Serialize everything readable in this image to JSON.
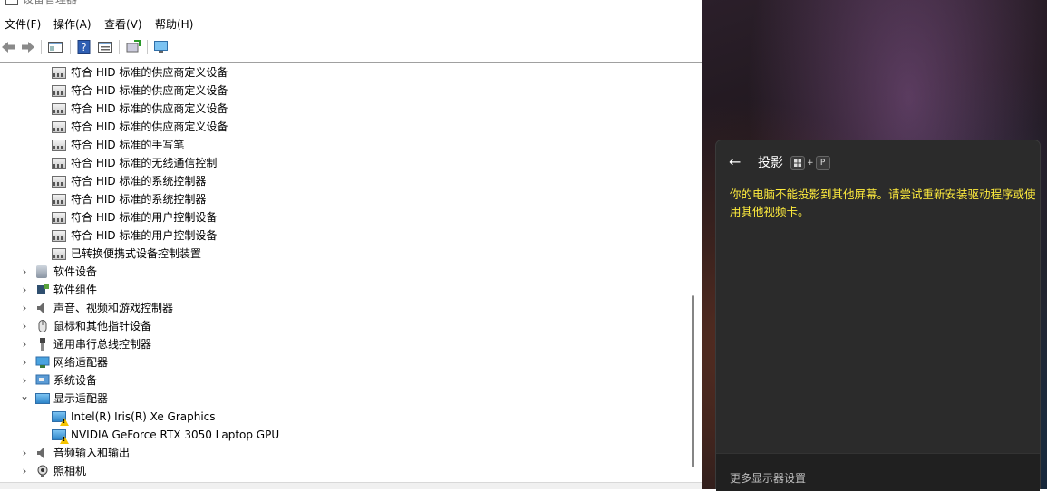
{
  "window": {
    "title": "设备管理器",
    "minimize": "—",
    "maximize": "☐",
    "close": "✕"
  },
  "menu": {
    "file": "文件(F)",
    "action": "操作(A)",
    "view": "查看(V)",
    "help": "帮助(H)"
  },
  "tree": {
    "hid_items": [
      "符合 HID 标准的供应商定义设备",
      "符合 HID 标准的供应商定义设备",
      "符合 HID 标准的供应商定义设备",
      "符合 HID 标准的供应商定义设备",
      "符合 HID 标准的手写笔",
      "符合 HID 标准的无线通信控制",
      "符合 HID 标准的系统控制器",
      "符合 HID 标准的系统控制器",
      "符合 HID 标准的用户控制设备",
      "符合 HID 标准的用户控制设备",
      "已转换便携式设备控制装置"
    ],
    "categories": [
      {
        "label": "软件设备",
        "icon": "software-device-icon"
      },
      {
        "label": "软件组件",
        "icon": "software-component-icon"
      },
      {
        "label": "声音、视频和游戏控制器",
        "icon": "sound-icon"
      },
      {
        "label": "鼠标和其他指针设备",
        "icon": "mouse-icon"
      },
      {
        "label": "通用串行总线控制器",
        "icon": "usb-icon"
      },
      {
        "label": "网络适配器",
        "icon": "network-icon"
      },
      {
        "label": "系统设备",
        "icon": "system-device-icon"
      },
      {
        "label": "显示适配器",
        "icon": "display-adapter-icon",
        "expanded": true
      }
    ],
    "display_adapters": [
      "Intel(R) Iris(R) Xe Graphics",
      "NVIDIA GeForce RTX 3050 Laptop GPU"
    ],
    "after": [
      {
        "label": "音频输入和输出",
        "icon": "audio-io-icon"
      },
      {
        "label": "照相机",
        "icon": "camera-icon"
      }
    ],
    "chevron_collapsed": "›",
    "chevron_expanded": "⌄"
  },
  "flyout": {
    "back": "←",
    "title": "投影",
    "key_plus": "+",
    "key_p": "P",
    "message": "你的电脑不能投影到其他屏幕。请尝试重新安装驱动程序或使用其他视频卡。",
    "footer_link": "更多显示器设置"
  },
  "colors": {
    "flyout_bg": "#2b2b2b",
    "warning_text": "#ffec3d",
    "warning_badge": "#f5c400"
  }
}
